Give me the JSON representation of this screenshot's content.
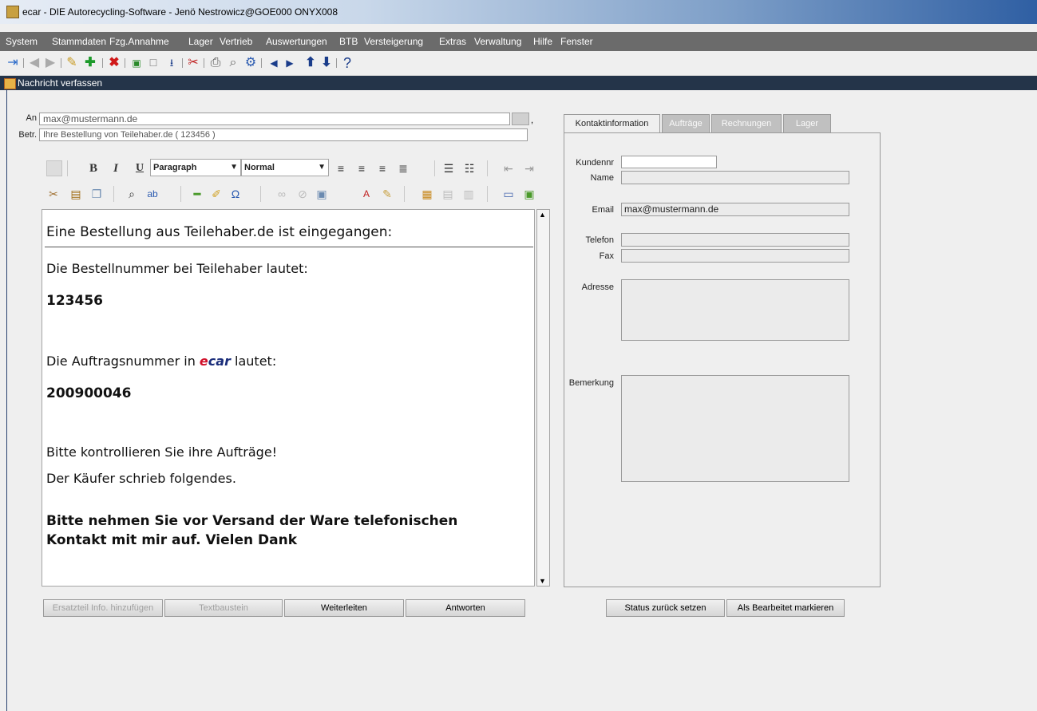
{
  "window": {
    "title": "ecar - DIE Autorecycling-Software - Jenö Nestrowicz@GOE000   ONYX008"
  },
  "menu": [
    "System",
    "Stammdaten",
    "Fzg.Annahme",
    "Lager",
    "Vertrieb",
    "Auswertungen",
    "BTB",
    "Versteigerung",
    "Extras",
    "Verwaltung",
    "Hilfe",
    "Fenster"
  ],
  "header": {
    "title": "Nachricht verfassen"
  },
  "form": {
    "to_label": "An",
    "to_value": "max@mustermann.de",
    "subject_label": "Betr.",
    "subject_value": "Ihre Bestellung von Teilehaber.de ( 123456 )",
    "to_suffix": ","
  },
  "editor_toolbar": {
    "bold": "B",
    "italic": "I",
    "underline": "U",
    "block_format": "Paragraph",
    "font_size": "Normal"
  },
  "editor": {
    "heading": "Eine Bestellung aus Teilehaber.de ist eingegangen:",
    "line1": "Die Bestellnummer bei Teilehaber lautet:",
    "order_no": "123456",
    "line2_prefix": "Die Auftragsnummer in ",
    "line2_brand_e": "e",
    "line2_brand_car": "car",
    "line2_suffix": " lautet:",
    "job_no": "200900046",
    "line3": "Bitte kontrollieren Sie ihre Aufträge!",
    "line4": "Der Käufer schrieb folgendes.",
    "note1": "Bitte nehmen Sie vor Versand der Ware telefonischen",
    "note2": "Kontakt mit mir auf. Vielen Dank"
  },
  "buttons": {
    "add_part": "Ersatzteil Info. hinzufügen",
    "text_block": "Textbaustein",
    "forward": "Weiterleiten",
    "reply": "Antworten",
    "reset_status": "Status zurück setzen",
    "mark_done": "Als Bearbeitet markieren"
  },
  "tabs": [
    "Kontaktinformation",
    "Aufträge",
    "Rechnungen",
    "Lager"
  ],
  "contact": {
    "customer_no_label": "Kundennr",
    "customer_no": "",
    "name_label": "Name",
    "name": "",
    "email_label": "Email",
    "email": "max@mustermann.de",
    "phone_label": "Telefon",
    "phone": "",
    "fax_label": "Fax",
    "fax": "",
    "address_label": "Adresse",
    "address": "",
    "remark_label": "Bemerkung",
    "remark": ""
  },
  "colors": {
    "menubar": "#6b6b6b",
    "header": "#243449",
    "brand_e": "#d0102a",
    "brand_car": "#1a2d7a"
  }
}
